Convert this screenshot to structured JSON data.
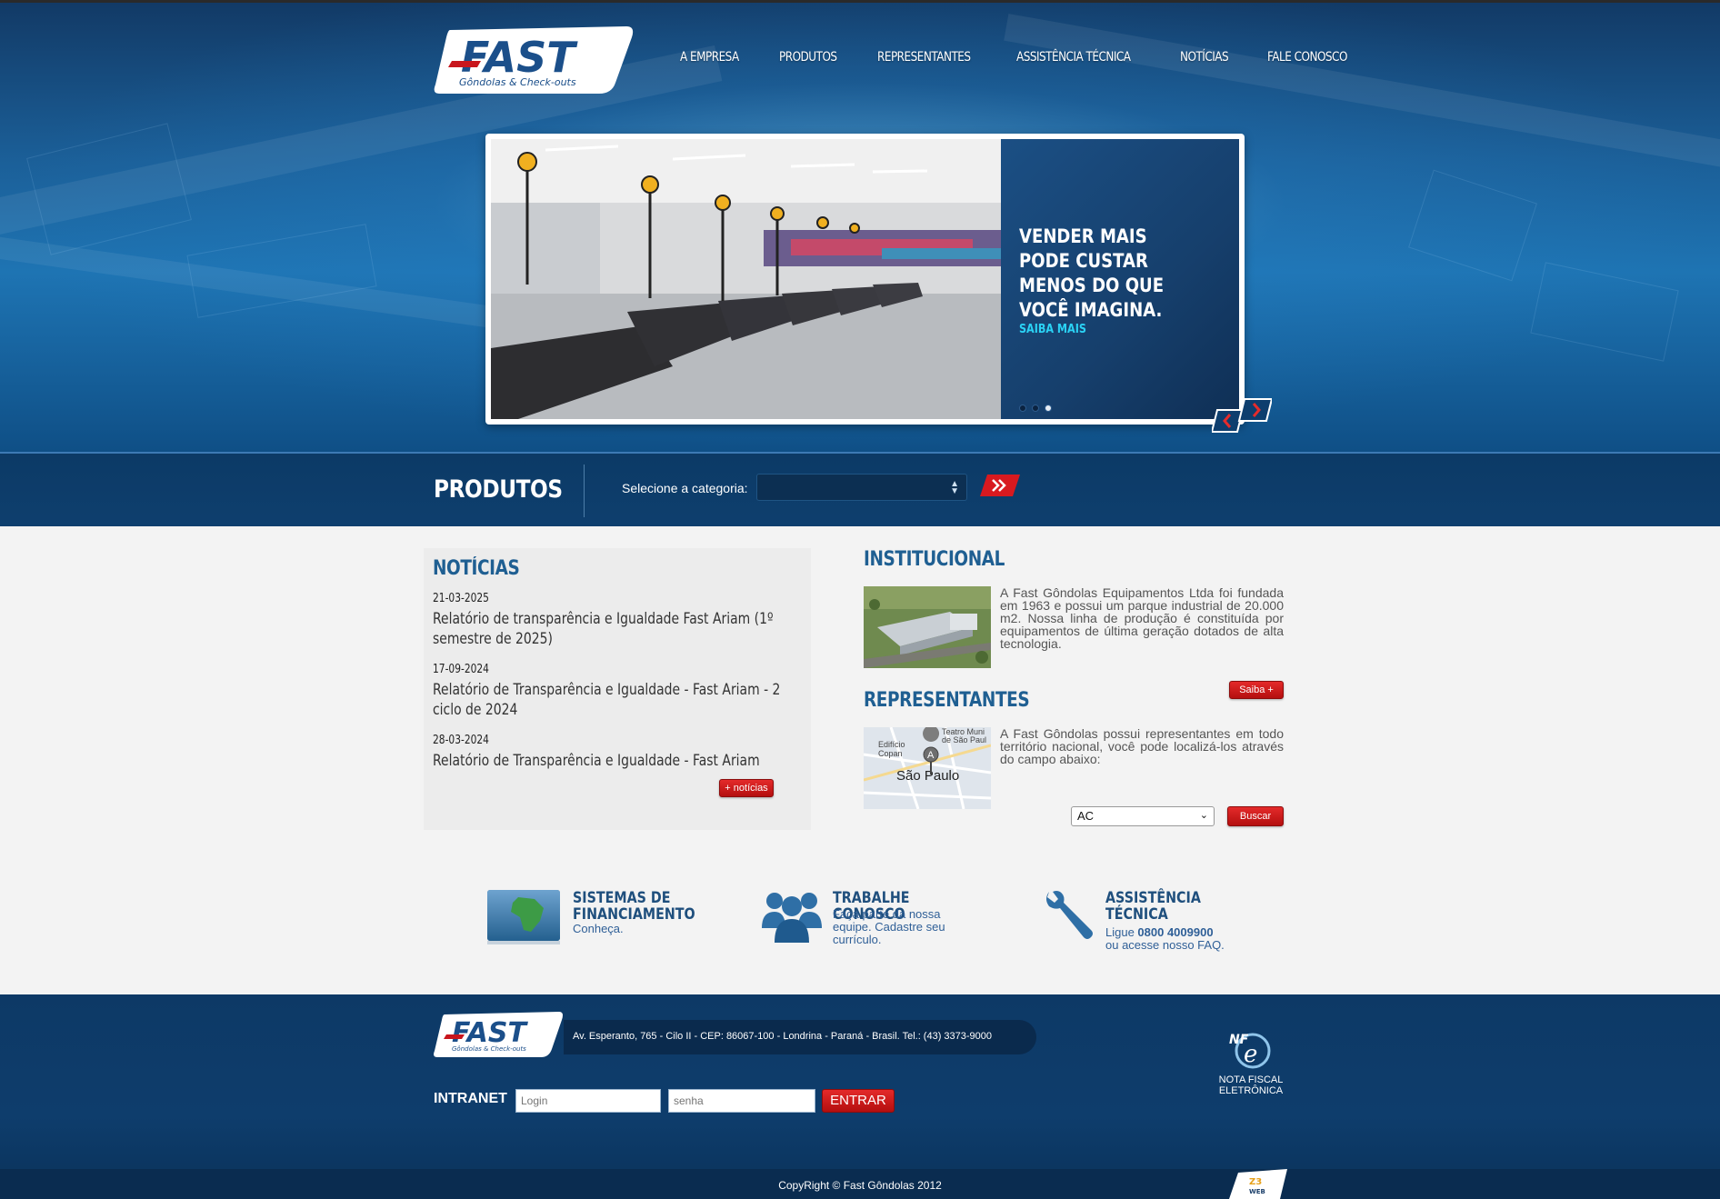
{
  "brand": {
    "name": "FAST",
    "tagline": "Gôndolas & Check-outs",
    "accent": "#c8161d",
    "primary": "#1f5f92"
  },
  "nav": {
    "items": [
      {
        "label": "A EMPRESA"
      },
      {
        "label": "PRODUTOS"
      },
      {
        "label": "REPRESENTANTES"
      },
      {
        "label": "ASSISTÊNCIA TÉCNICA"
      },
      {
        "label": "NOTÍCIAS"
      },
      {
        "label": "FALE CONOSCO"
      }
    ]
  },
  "slider": {
    "headline": "VENDER MAIS PODE CUSTAR MENOS DO QUE VOCÊ IMAGINA.",
    "link": "SAIBA MAIS",
    "dots": 3,
    "active_dot": 3,
    "photo_icon": "checkout-lanes-photo"
  },
  "products": {
    "title": "PRODUTOS",
    "select_label": "Selecione a categoria:",
    "select_value": "",
    "go_icon": "double-chevron-right-icon"
  },
  "news": {
    "title": "NOTÍCIAS",
    "items": [
      {
        "date": "21-03-2025",
        "title": "Relatório de transparência e Igualdade Fast Ariam (1º semestre de 2025)"
      },
      {
        "date": "17-09-2024",
        "title": "Relatório de Transparência e Igualdade - Fast Ariam - 2 ciclo de 2024"
      },
      {
        "date": "28-03-2024",
        "title": "Relatório de Transparência e Igualdade - Fast Ariam"
      }
    ],
    "more_label": "+ notícias"
  },
  "institucional": {
    "title": "INSTITUCIONAL",
    "text": "A Fast Gôndolas Equipamentos Ltda foi fundada em 1963 e possui um parque industrial de 20.000 m2. Nossa linha de produção é constituída por equipamentos de última geração dotados de alta tecnologia.",
    "button": "Saiba +"
  },
  "representantes": {
    "title": "REPRESENTANTES",
    "text": "A Fast Gôndolas possui representantes em todo território nacional, você pode localizá-los através do campo abaixo:",
    "select_value": "AC",
    "button": "Buscar",
    "map": {
      "label_city": "São Paulo",
      "label_1": "Edifício",
      "label_2": "Copan",
      "label_3": "Teatro Muni",
      "label_4": "de São Paul",
      "marker": "A"
    }
  },
  "features": [
    {
      "title": "SISTEMAS DE FINANCIAMENTO",
      "text": "Conheça.",
      "icon": "brazil-map-card-icon"
    },
    {
      "title": "TRABALHE CONOSCO",
      "text": "Faça parte da nossa equipe. Cadastre seu currículo.",
      "icon": "people-group-icon"
    },
    {
      "title": "ASSISTÊNCIA TÉCNICA",
      "text_prefix": "Ligue ",
      "phone": "0800 4009900",
      "text_suffix": "ou acesse nosso FAQ.",
      "icon": "wrench-icon"
    }
  ],
  "footer": {
    "address": "Av. Esperanto, 765 - Cilo II - CEP: 86067-100 - Londrina - Paraná - Brasil. Tel.: (43) 3373-9000",
    "intranet_label": "INTRANET",
    "login_placeholder": "Login",
    "password_placeholder": "senha",
    "enter_label": "ENTRAR",
    "nfe_label": "NOTA FISCAL ELETRÔNICA",
    "nfe_logo": "NF",
    "copyright": "CopyRight © Fast Gôndolas 2012",
    "dev_logo": "Z3 WEB"
  }
}
